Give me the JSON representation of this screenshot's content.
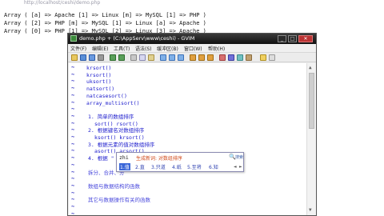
{
  "browser": {
    "url": "http://localhost/ceshi/demo.php"
  },
  "output_lines": [
    "Array ( [a] => Apache [1] => Linux [m] => MySQL [1] => PHP )",
    "Array ( [2] => PHP [m] => MySQL [1] => Linux [a] => Apache )",
    "Array ( [0] => PHP [1] => MySQL [2] => Linux [3] => Apache )"
  ],
  "gvim": {
    "title": "demo.php + (C:\\AppServ\\www\\ceshi) - GVIM",
    "window_buttons": [
      "_",
      "□",
      "✕"
    ],
    "menu": [
      "文件(F)",
      "编辑(E)",
      "工具(T)",
      "语法(S)",
      "缓冲区(B)",
      "窗口(W)",
      "帮助(H)"
    ],
    "editor_lines": [
      {
        "text": "krsort()",
        "cls": "code"
      },
      {
        "text": "krsort()",
        "cls": "code"
      },
      {
        "text": "uksort()",
        "cls": "code"
      },
      {
        "text": "natsort()",
        "cls": "code"
      },
      {
        "text": "natcasesort()",
        "cls": "code"
      },
      {
        "text": "array_multisort()",
        "cls": "code"
      },
      {
        "text": "",
        "cls": "code"
      },
      {
        "text": "1. 简单的数组排序",
        "cls": "head"
      },
      {
        "text": "sort() rsort()",
        "cls": "code2"
      },
      {
        "text": "2. 根据键名对数组排序",
        "cls": "head"
      },
      {
        "text": "ksort() krsort()",
        "cls": "code2"
      },
      {
        "text": "3. 根据元素的值对数组排序",
        "cls": "head"
      },
      {
        "text": "asort() arsort()",
        "cls": "code2"
      },
      {
        "text": "4. 根据 \" \"",
        "cls": "head"
      },
      {
        "text": "",
        "cls": "code"
      },
      {
        "text": "拆分、合并、分",
        "cls": "cn"
      },
      {
        "text": "",
        "cls": "code"
      },
      {
        "text": "数组与数据结构的函数",
        "cls": "cn"
      },
      {
        "text": "",
        "cls": "code"
      },
      {
        "text": "其它与数据操作有关的函数",
        "cls": "cn"
      },
      {
        "text": "",
        "cls": "code"
      },
      {
        "text": "",
        "cls": "code"
      }
    ]
  },
  "ime": {
    "pinyin": "zhi",
    "hint": "生成新词: 对数组排序",
    "options_label": "搜索",
    "candidates": [
      "1.值",
      "2.直",
      "3.只道",
      "4.纸",
      "5.至将",
      "6.知"
    ],
    "page_prev": "◄",
    "page_next": "►"
  }
}
